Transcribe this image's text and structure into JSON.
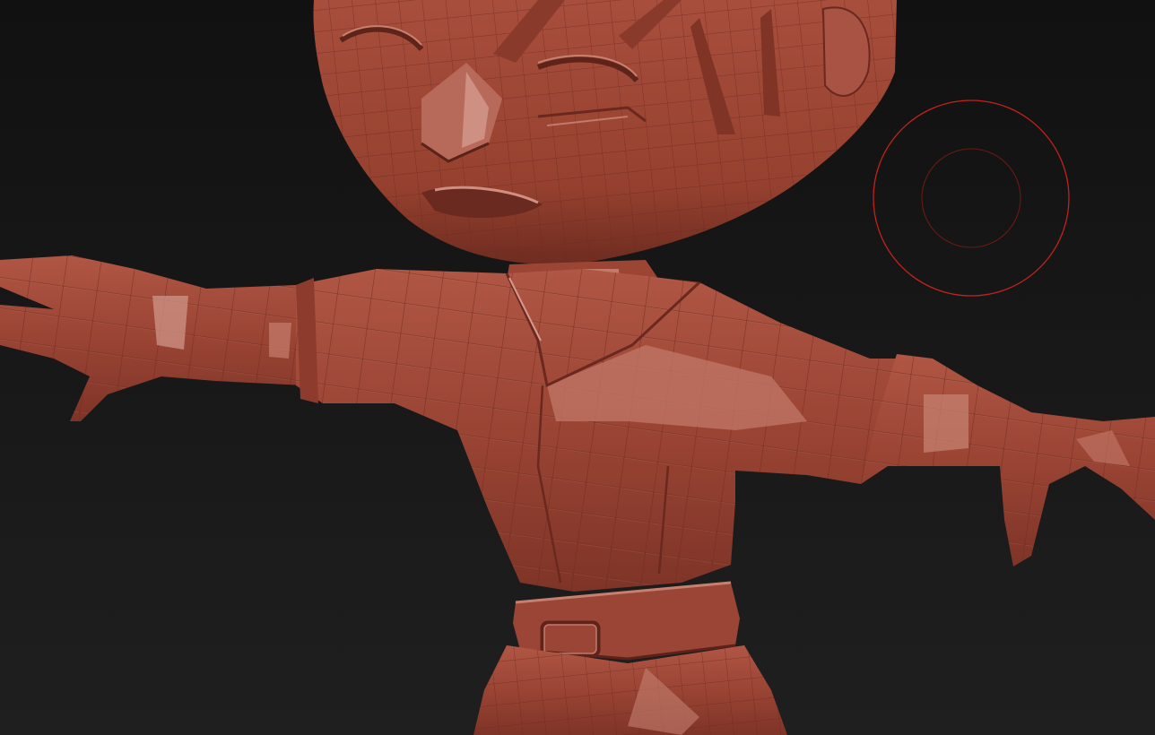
{
  "app": {
    "view": "3d-sculpt-viewport"
  },
  "viewport": {
    "background_top": "#111111",
    "background_bottom": "#1f1f1f"
  },
  "model": {
    "material_color": "#9e4636",
    "highlight_color": "#d98c7e",
    "shadow_color": "#5a2219",
    "wire_color": "#7a3024"
  },
  "brush_cursor": {
    "color": "#c0231b",
    "inner_color": "#6a1a14"
  }
}
